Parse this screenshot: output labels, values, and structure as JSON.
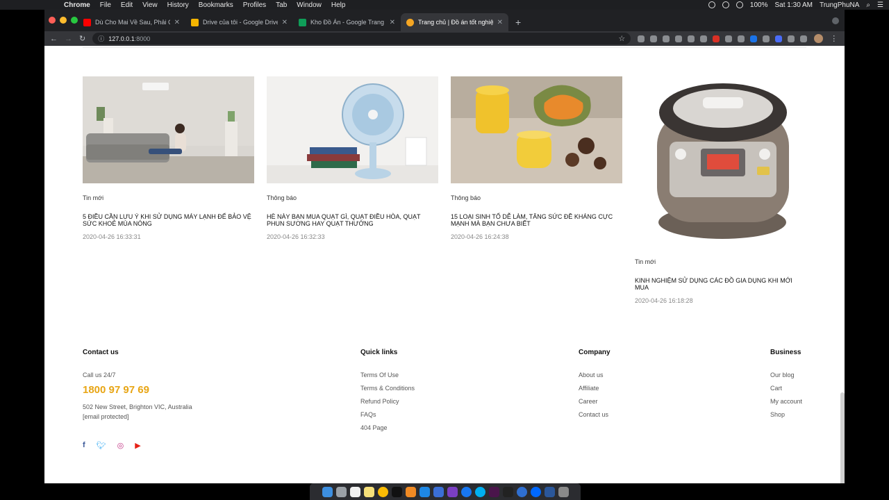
{
  "menubar": {
    "app": "Chrome",
    "items": [
      "File",
      "Edit",
      "View",
      "History",
      "Bookmarks",
      "Profiles",
      "Tab",
      "Window",
      "Help"
    ],
    "battery": "100%",
    "clock": "Sat 1:30 AM",
    "user": "TrungPhuNA"
  },
  "browser": {
    "tabs": [
      {
        "title": "Dù Cho Mai Về Sau, Phải Chăng",
        "color": "#ff0000"
      },
      {
        "title": "Drive của tôi - Google Drive",
        "color": "#f4b400"
      },
      {
        "title": "Kho Đồ Án - Google Trang tính",
        "color": "#0f9d58"
      },
      {
        "title": "Trang chủ | Đồ án tốt nghiệp",
        "color": "#f5a623"
      }
    ],
    "url_host": "127.0.0.1",
    "url_port": ":8000"
  },
  "news": [
    {
      "category": "Tin mới",
      "title": "5 điều cần lưu ý khi sử dụng máy lạnh để bảo vệ sức khoẻ mùa nóng",
      "date": "2020-04-26 16:33:31"
    },
    {
      "category": "Thông báo",
      "title": "Hè này bạn mua quạt gì, quạt điều hòa, quạt phun sương hay quạt thường",
      "date": "2020-04-26 16:32:33"
    },
    {
      "category": "Thông báo",
      "title": "15 loại sinh tố dễ làm, tăng sức đề kháng cực mạnh mà bạn chưa biết",
      "date": "2020-04-26 16:24:38"
    },
    {
      "category": "Tin mới",
      "title": "Kinh nghiệm sử dụng các đồ gia dụng khi mới mua",
      "date": "2020-04-26 16:18:28"
    }
  ],
  "footer": {
    "contact": {
      "heading": "Contact us",
      "call_label": "Call us 24/7",
      "phone": "1800 97 97 69",
      "address": "502 New Street, Brighton VIC, Australia",
      "email": "[email protected]"
    },
    "quick_links": {
      "heading": "Quick links",
      "links": [
        "Terms Of Use",
        "Terms & Conditions",
        "Refund Policy",
        "FAQs",
        "404 Page"
      ]
    },
    "company": {
      "heading": "Company",
      "links": [
        "About us",
        "Affiliate",
        "Career",
        "Contact us"
      ]
    },
    "business": {
      "heading": "Business",
      "links": [
        "Our blog",
        "Cart",
        "My account",
        "Shop"
      ]
    }
  },
  "colors": {
    "accent": "#e8a514",
    "facebook": "#3b5998",
    "twitter": "#1da1f2",
    "instagram": "#c13584",
    "youtube": "#e62117"
  }
}
